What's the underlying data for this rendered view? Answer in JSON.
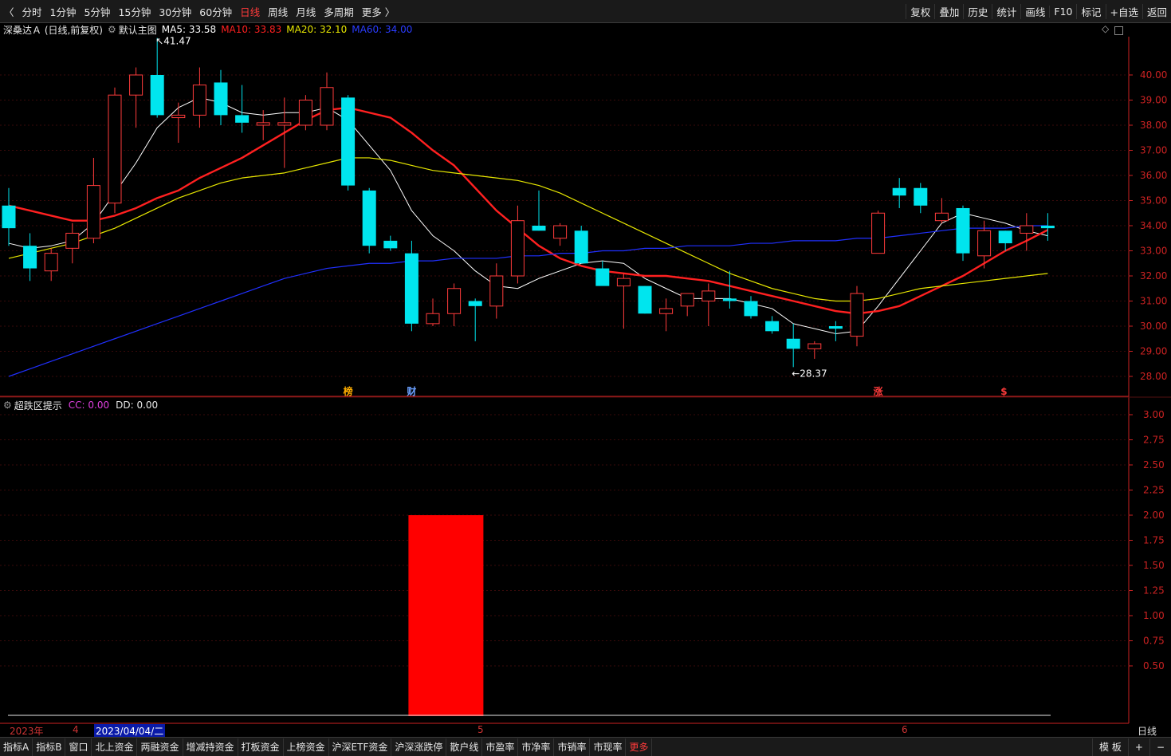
{
  "topbar": {
    "back_label": "〈",
    "periods": [
      "分时",
      "1分钟",
      "5分钟",
      "15分钟",
      "30分钟",
      "60分钟",
      "日线",
      "周线",
      "月线",
      "多周期",
      "更多 〉"
    ],
    "active_period": "日线",
    "tools": [
      "复权",
      "叠加",
      "历史",
      "统计",
      "画线",
      "F10",
      "标记",
      "+自选",
      "返回"
    ]
  },
  "main_legend": {
    "stock": "深桑达Ａ (日线,前复权)",
    "template": "默认主图",
    "ma5": "MA5: 33.58",
    "ma10": "MA10: 33.83",
    "ma20": "MA20: 32.10",
    "ma60": "MA60: 34.00"
  },
  "colors": {
    "up": "#ff3b3b",
    "down": "#00e5ee",
    "ma5": "#ffffff",
    "ma10": "#ff2020",
    "ma20": "#e6e600",
    "ma60": "#2030ff",
    "axis": "#cc2222",
    "signal": "#ff0000"
  },
  "price_axis": [
    "40.00",
    "39.00",
    "38.00",
    "37.00",
    "36.00",
    "35.00",
    "34.00",
    "33.00",
    "32.00",
    "31.00",
    "30.00",
    "29.00",
    "28.00"
  ],
  "annotations": {
    "high": "41.47",
    "low": "28.37",
    "high_prefix": "↖",
    "low_prefix": "←"
  },
  "event_markers": [
    {
      "label": "榜",
      "color": "#ffae00"
    },
    {
      "label": "财",
      "color": "#6aa0ff"
    },
    {
      "label": "涨",
      "color": "#ff3b3b"
    },
    {
      "label": "$",
      "color": "#ff3b3b"
    }
  ],
  "sub_legend": {
    "name": "超跌区提示",
    "cc": "CC: 0.00",
    "dd": "DD: 0.00"
  },
  "sub_axis": [
    "3.00",
    "2.75",
    "2.50",
    "2.25",
    "2.00",
    "1.75",
    "1.50",
    "1.25",
    "1.00",
    "0.75",
    "0.50"
  ],
  "date_axis": {
    "year": "2023年",
    "m4": "4",
    "cursor": "2023/04/04/二",
    "m5": "5",
    "m6": "6"
  },
  "period_label": "日线",
  "bottombar": {
    "items": [
      "指标A",
      "指标B",
      "窗口",
      "北上资金",
      "两融资金",
      "增减持资金",
      "打板资金",
      "上榜资金",
      "沪深ETF资金",
      "沪深涨跌停",
      "散户线",
      "市盈率",
      "市净率",
      "市销率",
      "市现率",
      "更多"
    ],
    "right": [
      "模 板",
      "+",
      "−"
    ]
  },
  "chart_data": [
    {
      "type": "candlestick",
      "title": "深桑达Ａ (日线,前复权)",
      "ylim": [
        27.5,
        41.6
      ],
      "candles": [
        {
          "o": 34.8,
          "h": 35.5,
          "l": 33.2,
          "c": 33.9
        },
        {
          "o": 33.2,
          "h": 33.7,
          "l": 31.8,
          "c": 32.3
        },
        {
          "o": 32.2,
          "h": 33.1,
          "l": 31.8,
          "c": 32.9
        },
        {
          "o": 33.1,
          "h": 34.1,
          "l": 32.5,
          "c": 33.7
        },
        {
          "o": 33.5,
          "h": 36.7,
          "l": 33.3,
          "c": 35.6
        },
        {
          "o": 34.9,
          "h": 39.5,
          "l": 34.5,
          "c": 39.2
        },
        {
          "o": 39.2,
          "h": 40.3,
          "l": 37.9,
          "c": 40.0
        },
        {
          "o": 40.0,
          "h": 41.47,
          "l": 38.3,
          "c": 38.4
        },
        {
          "o": 38.3,
          "h": 38.9,
          "l": 37.3,
          "c": 38.4
        },
        {
          "o": 38.4,
          "h": 40.3,
          "l": 37.9,
          "c": 39.6
        },
        {
          "o": 39.7,
          "h": 40.2,
          "l": 38.0,
          "c": 38.4
        },
        {
          "o": 38.4,
          "h": 39.6,
          "l": 37.7,
          "c": 38.1
        },
        {
          "o": 38.0,
          "h": 38.6,
          "l": 37.4,
          "c": 38.1
        },
        {
          "o": 38.0,
          "h": 39.1,
          "l": 36.3,
          "c": 38.1
        },
        {
          "o": 38.0,
          "h": 39.2,
          "l": 37.8,
          "c": 39.0
        },
        {
          "o": 38.0,
          "h": 40.1,
          "l": 37.8,
          "c": 39.5
        },
        {
          "o": 39.1,
          "h": 39.2,
          "l": 35.4,
          "c": 35.6
        },
        {
          "o": 35.4,
          "h": 35.5,
          "l": 32.9,
          "c": 33.2
        },
        {
          "o": 33.4,
          "h": 33.6,
          "l": 33.0,
          "c": 33.1
        },
        {
          "o": 32.9,
          "h": 33.4,
          "l": 29.8,
          "c": 30.1
        },
        {
          "o": 30.1,
          "h": 31.1,
          "l": 30.0,
          "c": 30.5
        },
        {
          "o": 30.5,
          "h": 31.7,
          "l": 30.0,
          "c": 31.5
        },
        {
          "o": 31.0,
          "h": 31.1,
          "l": 29.4,
          "c": 30.8
        },
        {
          "o": 30.8,
          "h": 32.5,
          "l": 30.3,
          "c": 32.0
        },
        {
          "o": 32.0,
          "h": 34.8,
          "l": 31.7,
          "c": 34.2
        },
        {
          "o": 34.0,
          "h": 35.4,
          "l": 33.8,
          "c": 33.8
        },
        {
          "o": 33.5,
          "h": 34.1,
          "l": 33.2,
          "c": 34.0
        },
        {
          "o": 33.8,
          "h": 34.0,
          "l": 32.5,
          "c": 32.5
        },
        {
          "o": 32.3,
          "h": 32.6,
          "l": 31.8,
          "c": 31.6
        },
        {
          "o": 31.6,
          "h": 32.1,
          "l": 29.9,
          "c": 31.9
        },
        {
          "o": 31.6,
          "h": 31.6,
          "l": 30.5,
          "c": 30.5
        },
        {
          "o": 30.5,
          "h": 31.1,
          "l": 29.8,
          "c": 30.7
        },
        {
          "o": 30.8,
          "h": 31.3,
          "l": 30.4,
          "c": 31.3
        },
        {
          "o": 31.0,
          "h": 31.7,
          "l": 30.0,
          "c": 31.4
        },
        {
          "o": 31.1,
          "h": 32.2,
          "l": 30.7,
          "c": 31.0
        },
        {
          "o": 31.0,
          "h": 31.2,
          "l": 30.3,
          "c": 30.4
        },
        {
          "o": 30.2,
          "h": 30.4,
          "l": 29.7,
          "c": 29.8
        },
        {
          "o": 29.5,
          "h": 30.1,
          "l": 28.37,
          "c": 29.1
        },
        {
          "o": 29.1,
          "h": 29.4,
          "l": 28.7,
          "c": 29.3
        },
        {
          "o": 30.0,
          "h": 30.2,
          "l": 29.4,
          "c": 29.9
        },
        {
          "o": 29.6,
          "h": 31.6,
          "l": 29.2,
          "c": 31.3
        },
        {
          "o": 32.9,
          "h": 34.6,
          "l": 32.9,
          "c": 34.5
        },
        {
          "o": 35.5,
          "h": 35.9,
          "l": 34.7,
          "c": 35.2
        },
        {
          "o": 35.5,
          "h": 35.7,
          "l": 34.5,
          "c": 34.8
        },
        {
          "o": 34.2,
          "h": 35.1,
          "l": 34.1,
          "c": 34.5
        },
        {
          "o": 34.7,
          "h": 34.8,
          "l": 32.6,
          "c": 32.9
        },
        {
          "o": 32.8,
          "h": 34.2,
          "l": 32.3,
          "c": 33.8
        },
        {
          "o": 33.8,
          "h": 33.8,
          "l": 33.0,
          "c": 33.3
        },
        {
          "o": 33.7,
          "h": 34.5,
          "l": 33.0,
          "c": 34.0
        },
        {
          "o": 34.0,
          "h": 34.5,
          "l": 33.4,
          "c": 33.9
        }
      ],
      "series": [
        {
          "name": "MA5",
          "values": [
            33.3,
            33.1,
            33.2,
            33.4,
            34.1,
            35.3,
            36.5,
            37.9,
            38.7,
            39.1,
            38.9,
            38.5,
            38.4,
            38.5,
            38.5,
            38.7,
            38.2,
            37.2,
            36.2,
            34.6,
            33.6,
            33.0,
            32.2,
            31.6,
            31.5,
            31.9,
            32.2,
            32.5,
            32.6,
            32.5,
            31.9,
            31.5,
            31.1,
            31.1,
            31.1,
            30.9,
            30.7,
            30.1,
            29.9,
            29.7,
            29.8,
            30.8,
            31.9,
            33.0,
            34.1,
            34.5,
            34.3,
            34.1,
            33.8,
            33.6
          ]
        },
        {
          "name": "MA10",
          "values": [
            34.8,
            34.6,
            34.4,
            34.2,
            34.2,
            34.4,
            34.7,
            35.1,
            35.4,
            35.9,
            36.3,
            36.7,
            37.2,
            37.7,
            38.2,
            38.6,
            38.7,
            38.5,
            38.3,
            37.7,
            37.0,
            36.4,
            35.5,
            34.6,
            33.9,
            33.2,
            32.7,
            32.4,
            32.2,
            32.1,
            32.0,
            32.0,
            31.9,
            31.8,
            31.6,
            31.4,
            31.2,
            31.0,
            30.8,
            30.6,
            30.5,
            30.6,
            30.8,
            31.2,
            31.6,
            32.0,
            32.5,
            33.0,
            33.4,
            33.83
          ]
        },
        {
          "name": "MA20",
          "values": [
            32.7,
            32.9,
            33.1,
            33.3,
            33.6,
            33.9,
            34.3,
            34.7,
            35.1,
            35.4,
            35.7,
            35.9,
            36.0,
            36.1,
            36.3,
            36.5,
            36.7,
            36.7,
            36.6,
            36.4,
            36.2,
            36.1,
            36.0,
            35.9,
            35.8,
            35.6,
            35.3,
            34.9,
            34.5,
            34.1,
            33.7,
            33.3,
            32.9,
            32.5,
            32.1,
            31.8,
            31.5,
            31.3,
            31.1,
            31.0,
            31.0,
            31.1,
            31.3,
            31.5,
            31.6,
            31.7,
            31.8,
            31.9,
            32.0,
            32.1
          ]
        },
        {
          "name": "MA60",
          "values": [
            28.0,
            28.3,
            28.6,
            28.9,
            29.2,
            29.5,
            29.8,
            30.1,
            30.4,
            30.7,
            31.0,
            31.3,
            31.6,
            31.9,
            32.1,
            32.3,
            32.4,
            32.5,
            32.5,
            32.6,
            32.6,
            32.7,
            32.7,
            32.7,
            32.8,
            32.8,
            32.9,
            32.9,
            33.0,
            33.0,
            33.1,
            33.1,
            33.2,
            33.2,
            33.2,
            33.3,
            33.3,
            33.4,
            33.4,
            33.4,
            33.5,
            33.5,
            33.6,
            33.7,
            33.8,
            33.9,
            33.9,
            33.9,
            34.0,
            34.0
          ]
        }
      ]
    },
    {
      "type": "bar",
      "title": "超跌区提示",
      "ylim": [
        0,
        3.1
      ],
      "bars": [
        {
          "index": 19,
          "value": 2.0
        }
      ],
      "series": [
        {
          "name": "CC",
          "values": [
            0.0
          ]
        },
        {
          "name": "DD",
          "values": [
            0.0
          ]
        }
      ]
    }
  ]
}
